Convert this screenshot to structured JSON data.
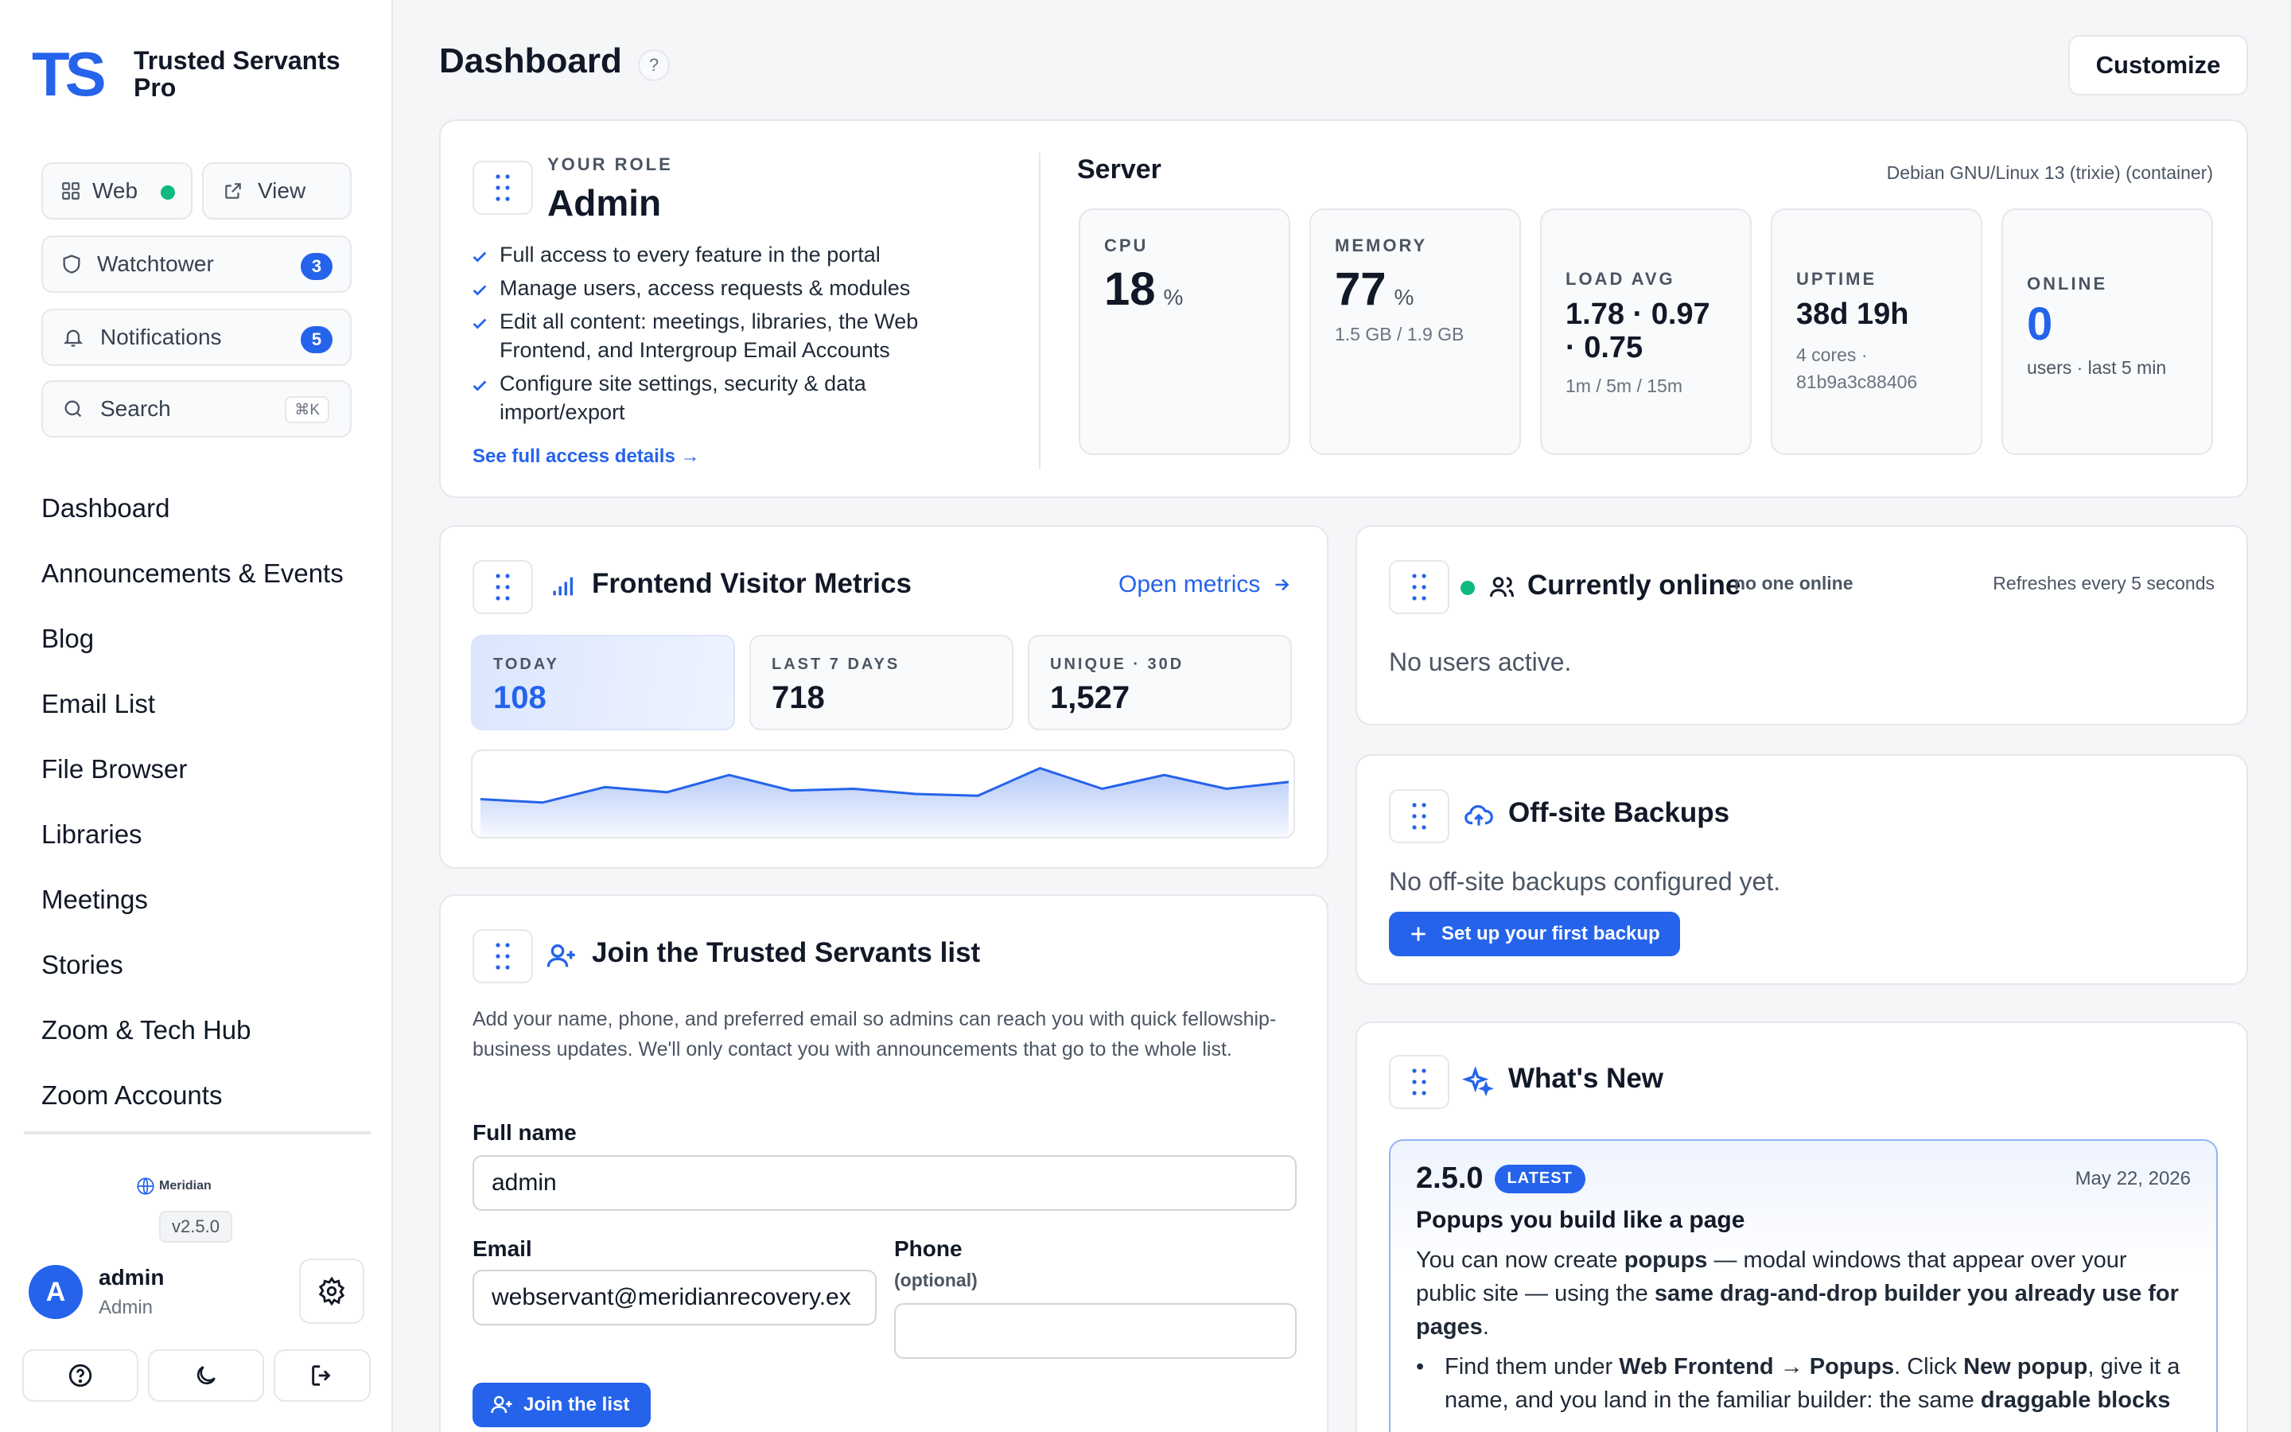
{
  "brand": {
    "name_line1": "Trusted Servants",
    "name_line2": "Pro",
    "logo_text": "TS"
  },
  "sidebar": {
    "web_label": "Web",
    "view_label": "View",
    "watchtower_label": "Watchtower",
    "watchtower_count": "3",
    "notifications_label": "Notifications",
    "notifications_count": "5",
    "search_label": "Search",
    "search_shortcut": "⌘K",
    "nav": [
      "Dashboard",
      "Announcements & Events",
      "Blog",
      "Email List",
      "File Browser",
      "Libraries",
      "Meetings",
      "Stories",
      "Zoom & Tech Hub",
      "Zoom Accounts"
    ],
    "org_name": "Meridian",
    "version": "v2.5.0",
    "user_initial": "A",
    "user_name": "admin",
    "user_role": "Admin"
  },
  "header": {
    "title": "Dashboard",
    "help": "?",
    "customize_label": "Customize"
  },
  "role": {
    "eyebrow": "YOUR ROLE",
    "title": "Admin",
    "items": [
      "Full access to every feature in the portal",
      "Manage users, access requests & modules",
      "Edit all content: meetings, libraries, the Web Frontend, and Intergroup Email Accounts",
      "Configure site settings, security & data import/export"
    ],
    "link": "See full access details →"
  },
  "server": {
    "title": "Server",
    "os": "Debian GNU/Linux 13 (trixie) (container)",
    "cpu": {
      "label": "CPU",
      "value": "18",
      "unit": "%"
    },
    "memory": {
      "label": "MEMORY",
      "value": "77",
      "unit": "%",
      "sub": "1.5 GB / 1.9 GB"
    },
    "load": {
      "label": "LOAD AVG",
      "value": "1.78 · 0.97 · 0.75",
      "sub": "1m / 5m / 15m"
    },
    "uptime": {
      "label": "UPTIME",
      "value": "38d 19h",
      "sub": "4 cores · 81b9a3c88406"
    },
    "online": {
      "label": "ONLINE",
      "value": "0",
      "sub": "users · last 5 min"
    }
  },
  "metrics": {
    "title": "Frontend Visitor Metrics",
    "open_link": "Open metrics",
    "today_label": "TODAY",
    "today_value": "108",
    "week_label": "LAST 7 DAYS",
    "week_value": "718",
    "unique_label": "UNIQUE · 30D",
    "unique_value": "1,527"
  },
  "chart_data": {
    "type": "area",
    "series": [
      {
        "values": [
          22,
          20,
          29,
          26,
          36,
          27,
          28,
          25,
          24,
          40,
          28,
          36,
          28,
          32
        ]
      }
    ],
    "ylim": [
      0,
      50
    ]
  },
  "online": {
    "title": "Currently online",
    "status": "no one online",
    "refresh": "Refreshes every 5 seconds",
    "empty": "No users active."
  },
  "backups": {
    "title": "Off-site Backups",
    "empty": "No off-site backups configured yet.",
    "cta": "Set up your first backup"
  },
  "join": {
    "title": "Join the Trusted Servants list",
    "desc": "Add your name, phone, and preferred email so admins can reach you with quick fellowship-business updates. We'll only contact you with announcements that go to the whole list.",
    "name_label": "Full name",
    "name_value": "admin",
    "email_label": "Email",
    "email_value": "webservant@meridianrecovery.ex",
    "phone_label": "Phone",
    "phone_hint": "(optional)",
    "phone_value": "",
    "submit": "Join the list"
  },
  "whatsnew": {
    "title": "What's New",
    "version": "2.5.0",
    "badge": "LATEST",
    "date": "May 22, 2026",
    "headline": "Popups you build like a page",
    "p_pre": "You can now create ",
    "p_b1": "popups",
    "p_mid": " — modal windows that appear over your public site — using the ",
    "p_b2": "same drag-and-drop builder you already use for pages",
    "p_end": ".",
    "li_pre": "Find them under ",
    "li_b1": "Web Frontend → Popups",
    "li_mid": ". Click ",
    "li_b2": "New popup",
    "li_mid2": ", give it a name, and you land in the familiar builder: the same ",
    "li_b3": "draggable blocks"
  },
  "colors": {
    "accent": "#2563eb",
    "online_dot": "#10b981"
  }
}
